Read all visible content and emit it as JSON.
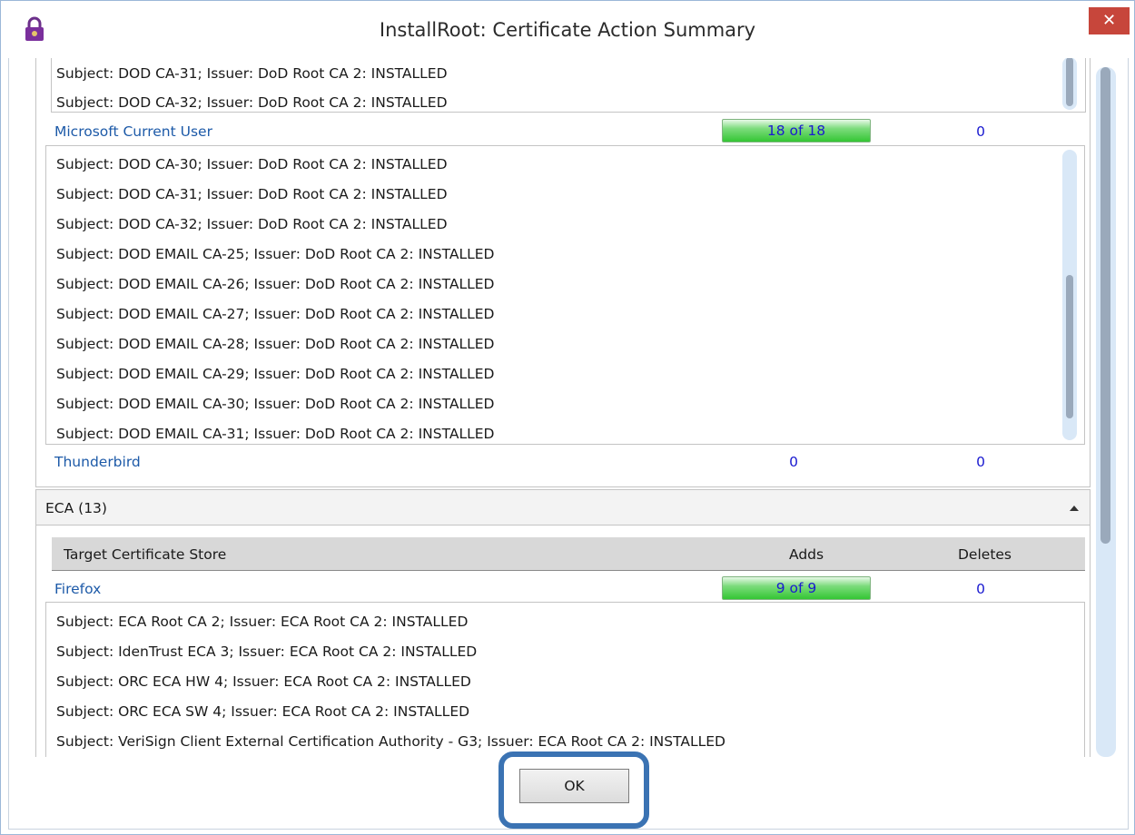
{
  "window": {
    "title": "InstallRoot: Certificate Action Summary",
    "close_glyph": "✕"
  },
  "dod": {
    "top_items": [
      "Subject: DOD CA-31; Issuer: DoD Root CA 2: INSTALLED",
      "Subject: DOD CA-32; Issuer: DoD Root CA 2: INSTALLED"
    ],
    "stores": [
      {
        "name": "Microsoft Current User",
        "adds": "18 of 18",
        "deletes": "0",
        "items": [
          "Subject: DOD CA-30; Issuer: DoD Root CA 2: INSTALLED",
          "Subject: DOD CA-31; Issuer: DoD Root CA 2: INSTALLED",
          "Subject: DOD CA-32; Issuer: DoD Root CA 2: INSTALLED",
          "Subject: DOD EMAIL CA-25; Issuer: DoD Root CA 2: INSTALLED",
          "Subject: DOD EMAIL CA-26; Issuer: DoD Root CA 2: INSTALLED",
          "Subject: DOD EMAIL CA-27; Issuer: DoD Root CA 2: INSTALLED",
          "Subject: DOD EMAIL CA-28; Issuer: DoD Root CA 2: INSTALLED",
          "Subject: DOD EMAIL CA-29; Issuer: DoD Root CA 2: INSTALLED",
          "Subject: DOD EMAIL CA-30; Issuer: DoD Root CA 2: INSTALLED",
          "Subject: DOD EMAIL CA-31; Issuer: DoD Root CA 2: INSTALLED"
        ]
      },
      {
        "name": "Thunderbird",
        "adds": "0",
        "deletes": "0"
      }
    ]
  },
  "eca": {
    "label": "ECA (13)",
    "columns": {
      "store": "Target Certificate Store",
      "adds": "Adds",
      "deletes": "Deletes"
    },
    "stores": [
      {
        "name": "Firefox",
        "adds": "9 of 9",
        "deletes": "0",
        "items": [
          "Subject: ECA Root CA 2; Issuer: ECA Root CA 2: INSTALLED",
          "Subject: IdenTrust ECA 3; Issuer: ECA Root CA 2: INSTALLED",
          "Subject: ORC ECA HW 4; Issuer: ECA Root CA 2: INSTALLED",
          "Subject: ORC ECA SW 4; Issuer: ECA Root CA 2: INSTALLED",
          "Subject: VeriSign Client External Certification Authority - G3; Issuer: ECA Root CA 2: INSTALLED"
        ]
      }
    ]
  },
  "ok_label": "OK",
  "icons": {
    "app": "lock-padlock-icon",
    "collapse": "chevron-up-icon"
  },
  "colors": {
    "link_blue": "#1d5aa8",
    "count_blue": "#1a1ad0",
    "progress_green": "#34c634",
    "close_red": "#c7463b",
    "highlight_blue": "#3b73b3"
  }
}
